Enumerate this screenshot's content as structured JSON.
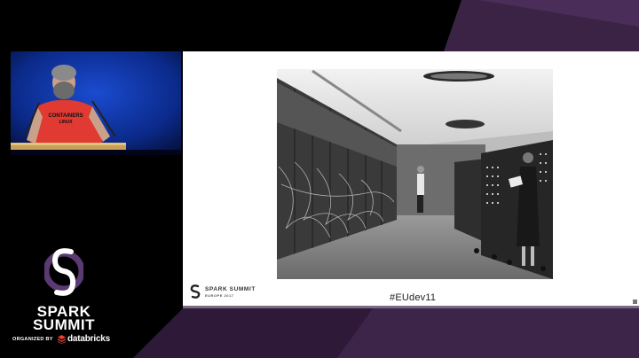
{
  "brand": {
    "name_line1": "SPARK",
    "name_line2": "SUMMIT",
    "organized_by": "ORGANIZED BY",
    "organizer": "databricks",
    "accent_color": "#5a3a72",
    "organizer_color": "#e8402e"
  },
  "speaker": {
    "shirt_line1": "CONTAINERS",
    "shirt_line2": "LINUX"
  },
  "slide": {
    "footer_logo_name": "SPARK SUMMIT",
    "footer_logo_sub": "EUROPE 2017",
    "hashtag": "#EUdev11"
  },
  "icons": {
    "brand_logo": "spark-summit-swirl-icon",
    "organizer_logo": "databricks-stack-icon",
    "slide_logo": "spark-summit-swirl-icon"
  }
}
